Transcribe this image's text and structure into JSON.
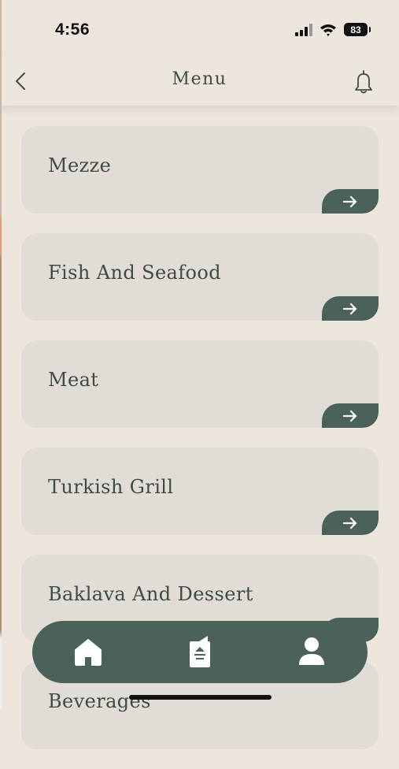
{
  "status": {
    "time": "4:56",
    "battery": "83"
  },
  "header": {
    "title": "Menu"
  },
  "categories": [
    {
      "label": "Mezze"
    },
    {
      "label": "Fish And Seafood"
    },
    {
      "label": "Meat"
    },
    {
      "label": "Turkish Grill"
    },
    {
      "label": "Baklava And Dessert"
    },
    {
      "label": "Beverages"
    }
  ],
  "nav": {
    "items": [
      "home-icon",
      "menu-icon",
      "profile-icon"
    ],
    "active": "home-icon"
  },
  "colors": {
    "background": "#ece6dd",
    "card": "#e2dcd6",
    "accent": "#4a625a"
  }
}
